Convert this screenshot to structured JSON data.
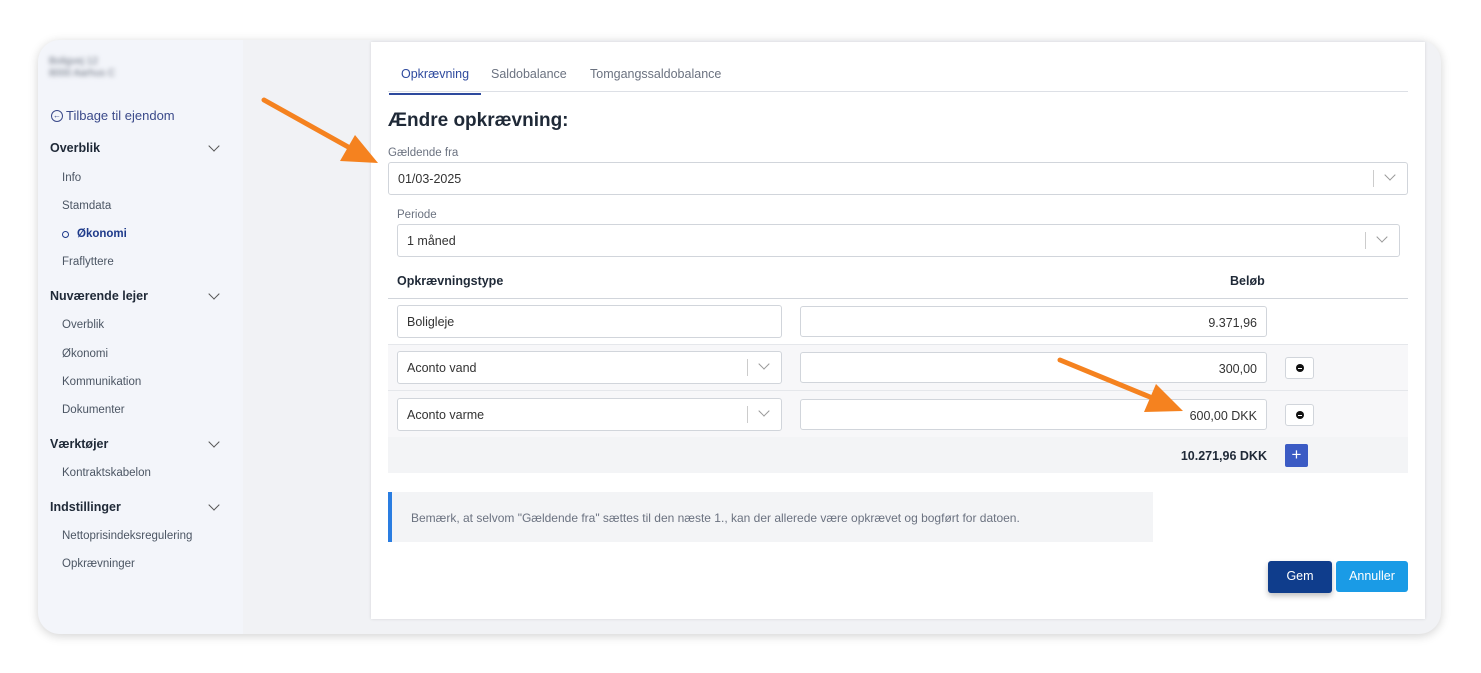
{
  "sidebar": {
    "address_line1": "Boligvej 12",
    "address_line2": "8000 Aarhus C",
    "back_label": "Tilbage til ejendom",
    "sections": [
      {
        "title": "Overblik",
        "items": [
          "Info",
          "Stamdata",
          "Økonomi",
          "Fraflyttere"
        ]
      },
      {
        "title": "Nuværende lejer",
        "items": [
          "Overblik",
          "Økonomi",
          "Kommunikation",
          "Dokumenter"
        ]
      },
      {
        "title": "Værktøjer",
        "items": [
          "Kontraktskabelon"
        ]
      },
      {
        "title": "Indstillinger",
        "items": [
          "Nettoprisindeksregulering",
          "Opkrævninger"
        ]
      }
    ],
    "active_item": "Økonomi"
  },
  "tabs": [
    "Opkrævning",
    "Saldobalance",
    "Tomgangssaldobalance"
  ],
  "form": {
    "heading": "Ændre opkrævning:",
    "valid_from_label": "Gældende fra",
    "valid_from_value": "01/03-2025",
    "period_label": "Periode",
    "period_value": "1 måned",
    "col_type": "Opkrævningstype",
    "col_amount": "Beløb",
    "rows": [
      {
        "type": "Boligleje",
        "amount": "9.371,96"
      },
      {
        "type": "Aconto vand",
        "amount": "300,00"
      },
      {
        "type": "Aconto varme",
        "amount": "600,00 DKK"
      }
    ],
    "total": "10.271,96 DKK",
    "add_symbol": "+",
    "note": "Bemærk, at selvom \"Gældende fra\" sættes til den næste 1., kan der allerede være opkrævet og bogført for datoen.",
    "save_label": "Gem",
    "cancel_label": "Annuller"
  },
  "colors": {
    "primary": "#0f3d8c",
    "accent": "#1a9be6",
    "plus": "#3b5bc4",
    "arrow": "#f5821f"
  }
}
